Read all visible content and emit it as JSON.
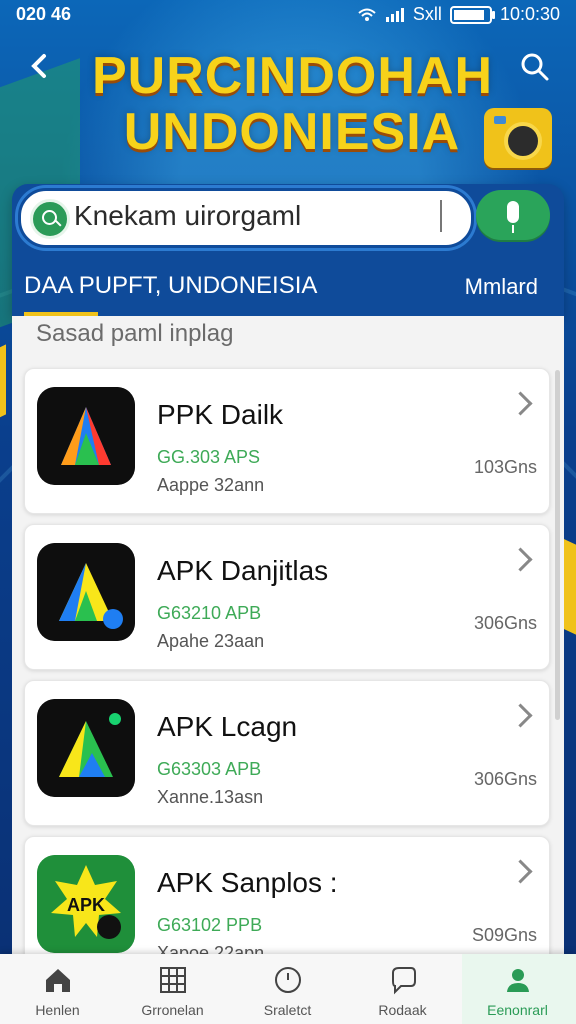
{
  "status_bar": {
    "left": "020 46",
    "right_time": "10:0:30",
    "carrier": "Sxll"
  },
  "header": {
    "title_line_1": "PURCINDOHAH",
    "title_line_2": "UNDONIESIA"
  },
  "search": {
    "value": "Knekam uirorgaml",
    "placeholder": "Knekam uirorgaml"
  },
  "tabs": {
    "active": "DAA PUPFT, UNDONEISIA",
    "more": "Mmlard"
  },
  "section": {
    "heading": "Sasad paml inplag"
  },
  "apps": [
    {
      "name": "PPK Dailk",
      "meta": "GG.303 APS",
      "sub": "Aappe 32ann",
      "right": "103Gns",
      "icon": "apk-dark-icon"
    },
    {
      "name": "APK Danjitlas",
      "meta": "G63210 APB",
      "sub": "Apahe 23aan",
      "right": "306Gns",
      "icon": "apk-dark-icon"
    },
    {
      "name": "APK Lcagn",
      "meta": "G63303 APB",
      "sub": "Xanne.13asn",
      "right": "306Gns",
      "icon": "apk-dark-icon"
    },
    {
      "name": "APK Sanplos :",
      "meta": "G63102 PPB",
      "sub": "Xapoe 22apn",
      "right": "S09Gns",
      "icon": "apk-green-icon",
      "icon_text": "APK"
    }
  ],
  "bottom_nav": [
    {
      "label": "Henlen",
      "icon": "home-icon"
    },
    {
      "label": "Grronelan",
      "icon": "grid-icon"
    },
    {
      "label": "Sraletct",
      "icon": "clock-icon"
    },
    {
      "label": "Rodaak",
      "icon": "chat-icon"
    },
    {
      "label": "Eenonrarl",
      "icon": "user-icon",
      "active": true
    }
  ],
  "colors": {
    "brand_blue": "#0f4b9a",
    "accent_yellow": "#f0c21a",
    "accent_green": "#2aa45a"
  }
}
